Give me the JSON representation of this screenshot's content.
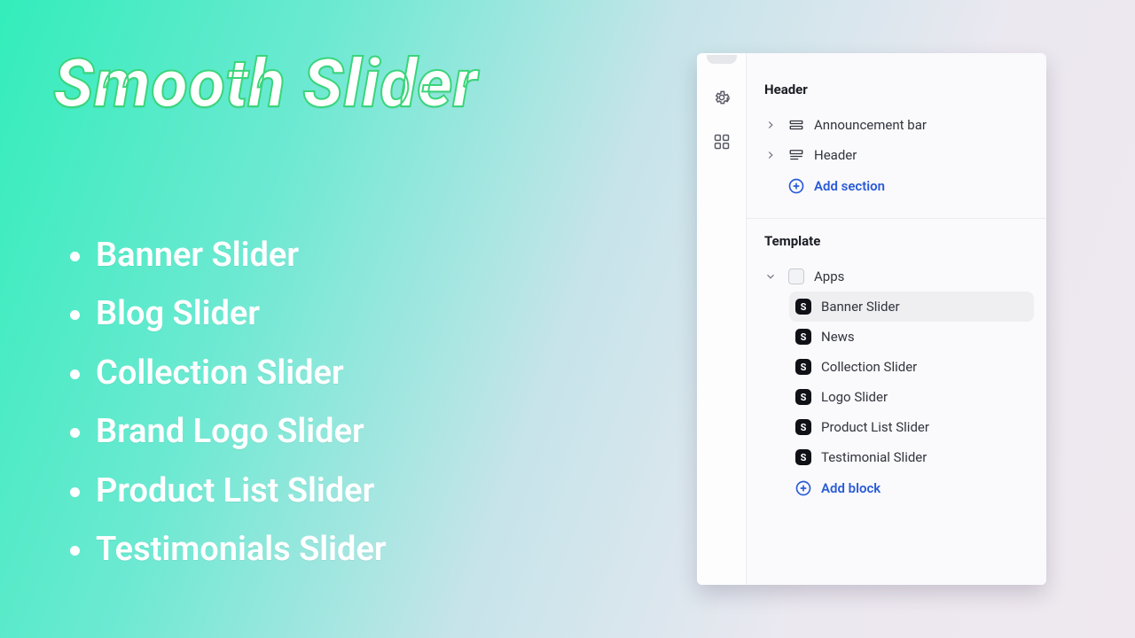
{
  "hero": {
    "title": "Smooth Slider",
    "features": [
      "Banner Slider",
      "Blog Slider",
      "Collection Slider",
      "Brand Logo Slider",
      "Product List Slider",
      "Testimonials Slider"
    ]
  },
  "editor": {
    "header": {
      "title": "Header",
      "items": [
        {
          "label": "Announcement bar"
        },
        {
          "label": "Header"
        }
      ],
      "add_section_label": "Add section"
    },
    "template": {
      "title": "Template",
      "apps_label": "Apps",
      "blocks": [
        {
          "label": "Banner Slider",
          "selected": true
        },
        {
          "label": "News",
          "selected": false
        },
        {
          "label": "Collection Slider",
          "selected": false
        },
        {
          "label": "Logo Slider",
          "selected": false
        },
        {
          "label": "Product List Slider",
          "selected": false
        },
        {
          "label": "Testimonial Slider",
          "selected": false
        }
      ],
      "add_block_label": "Add block"
    }
  },
  "colors": {
    "accent_link": "#2a5bd7",
    "panel_bg": "#fafafc"
  }
}
